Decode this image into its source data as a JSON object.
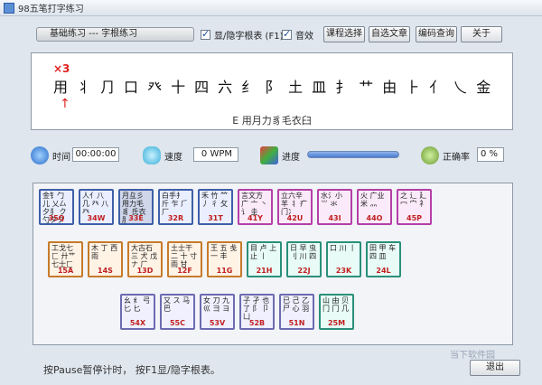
{
  "window": {
    "title": "98五笔打字练习"
  },
  "toolbar": {
    "mode": "基础练习 --- 字根练习",
    "show_table_label": "显/隐字根表 (F1)",
    "sound_label": "音效",
    "course_select": "课程选择",
    "custom_article": "自选文章",
    "code_lookup": "编码查询",
    "about": "关于"
  },
  "practice": {
    "error_count": "×3",
    "characters": [
      "用",
      "⺦",
      "⺆",
      "口",
      "癶",
      "十",
      "四",
      "六",
      "纟",
      "阝",
      "土",
      "皿",
      "扌",
      "艹",
      "由",
      "⺊",
      "⺅",
      "乀",
      "金"
    ],
    "cursor": "↑",
    "hint": "E 用月力豸毛衣臼"
  },
  "stats": {
    "time_label": "时间",
    "time_value": "00:00:00",
    "speed_label": "速度",
    "speed_value": "0 WPM",
    "progress_label": "进度",
    "accuracy_label": "正确率",
    "accuracy_value": "0 %"
  },
  "keyboard": {
    "row1": [
      {
        "roots": "金钅勹儿 乂厶夕犭 ク勺タク",
        "code": "35Q",
        "color": "blue"
      },
      {
        "roots": "人亻八 几 癶 八癶",
        "code": "34W",
        "color": "blue"
      },
      {
        "roots": "月彑彡 用力毛豸 氏衣⺼",
        "code": "33E",
        "color": "blue",
        "selected": true
      },
      {
        "roots": "白手扌 斤 乍 ⺁厂",
        "code": "32R",
        "color": "blue"
      },
      {
        "roots": "禾 竹 ⺮ 丿 彳 攵",
        "code": "31T",
        "color": "blue"
      },
      {
        "roots": "言文方 广 亠 丶 讠 圭",
        "code": "41Y",
        "color": "pink"
      },
      {
        "roots": "立六辛 羊 丬 疒 门冫",
        "code": "42U",
        "color": "pink"
      },
      {
        "roots": "水氵小 ⺌ 氺",
        "code": "43I",
        "color": "pink"
      },
      {
        "roots": "火 广业 米 灬",
        "code": "44O",
        "color": "pink"
      },
      {
        "roots": "之 辶 廴 冖 宀 礻",
        "code": "45P",
        "color": "pink"
      }
    ],
    "row2": [
      {
        "roots": "工戈七匚 廾艹 七士匚",
        "code": "15A",
        "color": "orange"
      },
      {
        "roots": "木 丁 西 雨",
        "code": "14S",
        "color": "orange"
      },
      {
        "roots": "大古石 三 犬 戊 ナ 厂",
        "code": "13D",
        "color": "orange"
      },
      {
        "roots": "土士干 二 十 寸 雨 甘",
        "code": "12F",
        "color": "orange"
      },
      {
        "roots": "王 五 戋 一 丰",
        "code": "11G",
        "color": "orange"
      },
      {
        "roots": "目 卢 上 止 丨",
        "code": "21H",
        "color": "green"
      },
      {
        "roots": "日 早 虫 刂 川 四",
        "code": "22J",
        "color": "green"
      },
      {
        "roots": "口 川 丨",
        "code": "23K",
        "color": "green"
      },
      {
        "roots": "田 甲 车 四 皿",
        "code": "24L",
        "color": "green"
      }
    ],
    "row3": [
      {
        "roots": "幺 纟 弓 匕 匕",
        "code": "54X",
        "color": "purple"
      },
      {
        "roots": "又 ス 马 巴",
        "code": "55C",
        "color": "purple"
      },
      {
        "roots": "女 刀 九 巛 彐 ヨ",
        "code": "53V",
        "color": "purple"
      },
      {
        "roots": "子 孑 也 了 阝 卩 凵",
        "code": "52B",
        "color": "purple"
      },
      {
        "roots": "已 己 乙 尸 心 羽",
        "code": "51N",
        "color": "purple"
      },
      {
        "roots": "山 由 贝 冂 冂 几",
        "code": "25M",
        "color": "green"
      }
    ]
  },
  "footer": {
    "text": "按Pause暂停计时， 按F1显/隐字根表。",
    "exit": "退出"
  },
  "watermark": "当下软件园"
}
